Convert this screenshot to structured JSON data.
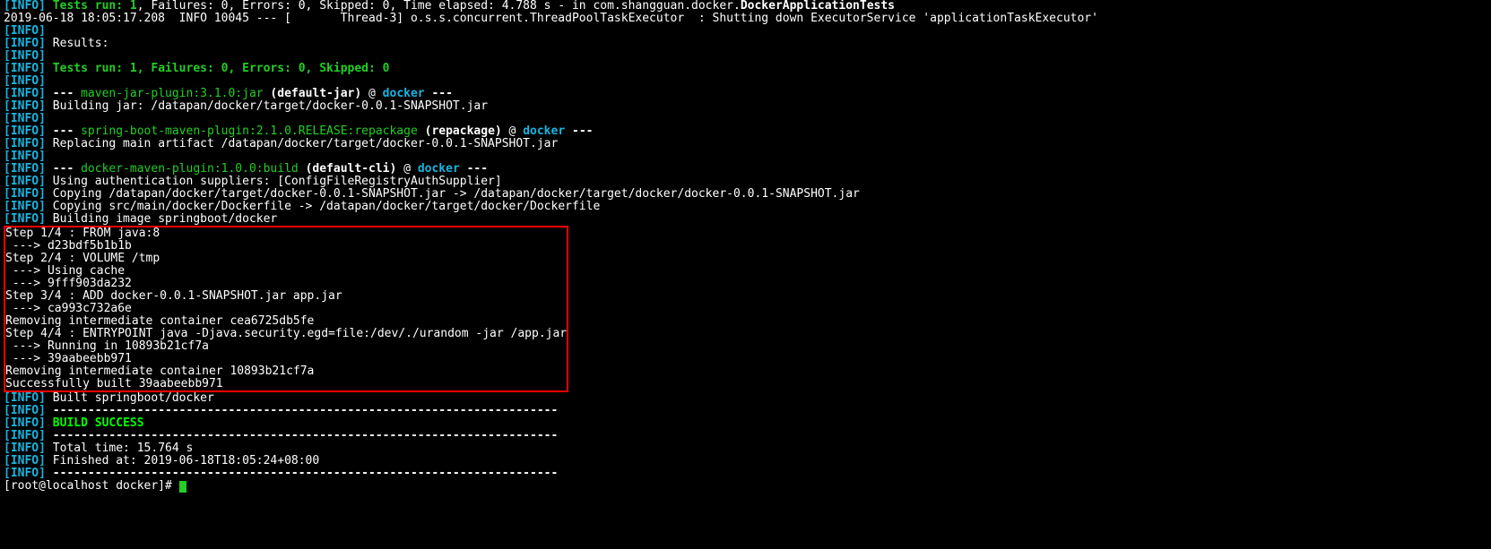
{
  "tags": {
    "info": "[INFO]"
  },
  "lines": {
    "l0_a": " ",
    "l0_b": "Tests run: 1",
    "l0_c": ", Failures: 0, Errors: 0, Skipped: 0, Time elapsed: 4.788 s - in com.shangguan.docker.",
    "l0_d": "DockerApplicationTests",
    "l1": "2019-06-18 18:05:17.208  INFO 10045 --- [       Thread-3] o.s.s.concurrent.ThreadPoolTaskExecutor  : Shutting down ExecutorService 'applicationTaskExecutor'",
    "l2": " ",
    "l3": " Results:",
    "l4": " ",
    "l5_a": " ",
    "l5_b": "Tests run: 1, Failures: 0, Errors: 0, Skipped: 0",
    "l6": " ",
    "l7_a": " ",
    "l7_b": "--- ",
    "l7_c": "maven-jar-plugin:3.1.0:jar",
    "l7_d": " (default-jar)",
    "l7_e": " @ ",
    "l7_f": "docker",
    "l7_g": " ---",
    "l8": " Building jar: /datapan/docker/target/docker-0.0.1-SNAPSHOT.jar",
    "l9": " ",
    "l10_a": " ",
    "l10_b": "--- ",
    "l10_c": "spring-boot-maven-plugin:2.1.0.RELEASE:repackage",
    "l10_d": " (repackage)",
    "l10_e": " @ ",
    "l10_f": "docker",
    "l10_g": " ---",
    "l11": " Replacing main artifact /datapan/docker/target/docker-0.0.1-SNAPSHOT.jar",
    "l12": " ",
    "l13_a": " ",
    "l13_b": "--- ",
    "l13_c": "docker-maven-plugin:1.0.0:build",
    "l13_d": " (default-cli)",
    "l13_e": " @ ",
    "l13_f": "docker",
    "l13_g": " ---",
    "l14": " Using authentication suppliers: [ConfigFileRegistryAuthSupplier]",
    "l15": " Copying /datapan/docker/target/docker-0.0.1-SNAPSHOT.jar -> /datapan/docker/target/docker/docker-0.0.1-SNAPSHOT.jar",
    "l16": " Copying src/main/docker/Dockerfile -> /datapan/docker/target/docker/Dockerfile",
    "l17": " Building image springboot/docker",
    "box": [
      "Step 1/4 : FROM java:8",
      " ---> d23bdf5b1b1b",
      "Step 2/4 : VOLUME /tmp",
      " ---> Using cache",
      " ---> 9fff903da232",
      "Step 3/4 : ADD docker-0.0.1-SNAPSHOT.jar app.jar",
      " ---> ca993c732a6e",
      "Removing intermediate container cea6725db5fe",
      "Step 4/4 : ENTRYPOINT java -Djava.security.egd=file:/dev/./urandom -jar /app.jar",
      " ---> Running in 10893b21cf7a",
      " ---> 39aabeebb971",
      "Removing intermediate container 10893b21cf7a",
      "Successfully built 39aabeebb971"
    ],
    "l31": " Built springboot/docker",
    "l32_a": " ",
    "l32_b": "------------------------------------------------------------------------",
    "l33_a": " ",
    "l33_b": "BUILD SUCCESS",
    "l34_a": " ",
    "l34_b": "------------------------------------------------------------------------",
    "l35": " Total time: 15.764 s",
    "l36": " Finished at: 2019-06-18T18:05:24+08:00",
    "l37_a": " ",
    "l37_b": "------------------------------------------------------------------------",
    "prompt": "[root@localhost docker]# "
  }
}
